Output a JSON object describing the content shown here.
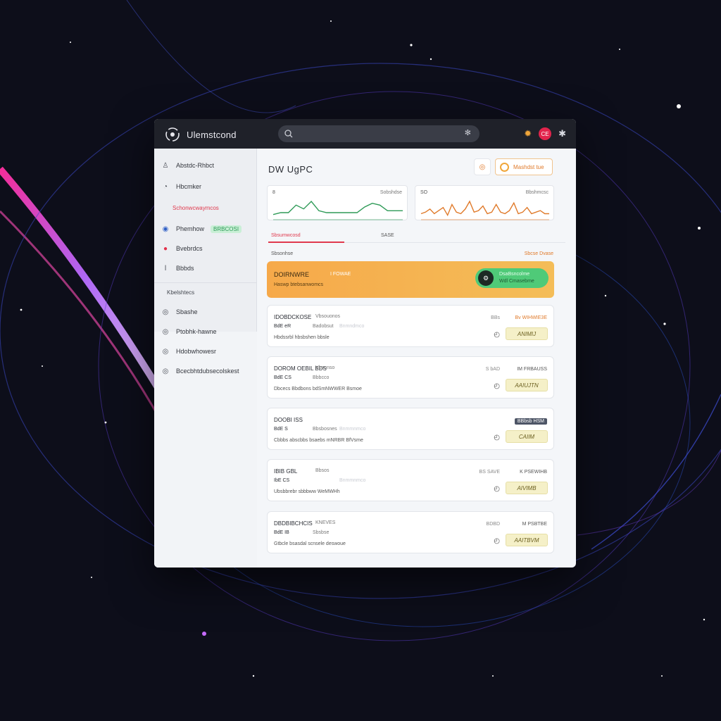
{
  "app": {
    "name": "Ulemstcond",
    "search": {
      "placeholder": "",
      "mic_icon": "mic-icon"
    },
    "badge": "CE"
  },
  "sidebar": {
    "items": [
      {
        "label": "Abstdc-Rhbct",
        "icon": "user-icon"
      },
      {
        "label": "Hbcmker",
        "icon": "clock-icon"
      },
      {
        "label": "Schonwcwaymcos",
        "icon": ""
      },
      {
        "label": "Phemhow",
        "badge": "BRBCOSI",
        "icon": "globe-icon"
      },
      {
        "label": "Bvebrdcs",
        "icon": "alert-icon"
      },
      {
        "label": "Bbbds",
        "icon": "pin-icon"
      }
    ],
    "section_label": "Kbelshtecs",
    "section_items": [
      {
        "label": "Sbashe",
        "icon": "circle-icon"
      },
      {
        "label": "Ptobhk-hawne",
        "icon": "circle-icon"
      },
      {
        "label": "Hdobwhowesr",
        "icon": "circle-icon"
      },
      {
        "label": "Bcecbhtdubsecolskest",
        "icon": "circle-icon"
      }
    ]
  },
  "main": {
    "title": "DW UgPC",
    "square_button_icon": "sun-icon",
    "orange_button": "Mashdst tue",
    "charts": [
      {
        "left_label": "8",
        "right_label": "Sobshdse"
      },
      {
        "left_label": "SO",
        "right_label": "Bbshmcsc"
      }
    ],
    "tabs": [
      "Sbsumwcosd",
      "SASE"
    ],
    "section_left": "Sbsonhse",
    "section_right": "Sbcse Dvase",
    "banner": {
      "title": "DOIRNWRE",
      "title_suffix": "I FOWAE",
      "subtitle": "Haswp btebsanwomcs",
      "cta_line1": "DsaBsncolme",
      "cta_line2": "Wdl Cmasebme",
      "cta_icon": "gear-icon"
    },
    "rows": [
      {
        "title": "IDOBDCKOSE",
        "title_b": "Vbsouonos",
        "meta1": "BdE eR",
        "meta2": "Badobsut",
        "meta3": "Bnmndmco",
        "desc": "Hbdssrbl hbsbshen bbsle",
        "right1": "BBs",
        "right2": "Bv WIHWIE3E",
        "right2_style": "orange",
        "action": "ANIMIJ"
      },
      {
        "title": "DOROM OEBIL BDS",
        "title_b": "Vbsonso",
        "meta1": "BdE CS",
        "meta2": "Bbbcco",
        "meta3": "",
        "desc": "Dbcecs Bbdbons bdSmNWWER Bsmoe",
        "right1": "S bAD",
        "right2": "IM FRBAUSS",
        "right2_style": "",
        "action": "AAIUJTN"
      },
      {
        "title": "DOOBI ISS",
        "title_b": "",
        "meta1": "BdE S",
        "meta2": "Bbsbosnes",
        "meta3": "Bnmmnmco",
        "desc": "Cbbbs abscbbs bsaebs mNRBR BfVsme",
        "right1": "",
        "right2": "BBbsb HSM",
        "right2_style": "tag",
        "action": "CAIIM"
      },
      {
        "title": "IBIB GBL",
        "title_b": "Bbsos",
        "meta1": "IbE CS",
        "meta2": "",
        "meta3": "Bnmmnmco",
        "desc": "Ubsbbrebr sbbbww WeMWHh",
        "right1": "BS SAVE",
        "right2": "K PSEWIHB",
        "right2_style": "",
        "action": "AIVIMB"
      },
      {
        "title": "DBDBIBCHCIS",
        "title_b": "KNEVES",
        "meta1": "BdE IB",
        "meta2": "Sbsbse",
        "meta3": "",
        "desc": "Gtbcle bsasdal scnsele deswoue",
        "right1": "BDBD",
        "right2": "M PSBTBE",
        "right2_style": "",
        "action": "AAITBVM"
      }
    ]
  },
  "chart_data": [
    {
      "type": "line",
      "series": [
        {
          "values": [
            2,
            3,
            3,
            7,
            5,
            9,
            4,
            3,
            3,
            3,
            3,
            3,
            6,
            8,
            7,
            4,
            4,
            4
          ]
        }
      ],
      "color": "#2e9a57"
    },
    {
      "type": "line",
      "series": [
        {
          "values": [
            3,
            4,
            6,
            3,
            5,
            7,
            2,
            9,
            4,
            3,
            6,
            11,
            4,
            5,
            8,
            3,
            4,
            9,
            4,
            3,
            5,
            10,
            3,
            4,
            7,
            3,
            4,
            5,
            3,
            3
          ]
        }
      ],
      "color": "#e07a2a"
    }
  ],
  "colors": {
    "accent_orange": "#f6a94a",
    "accent_red": "#e0394d",
    "accent_green": "#4fca78",
    "titlebar": "#1f2129"
  }
}
